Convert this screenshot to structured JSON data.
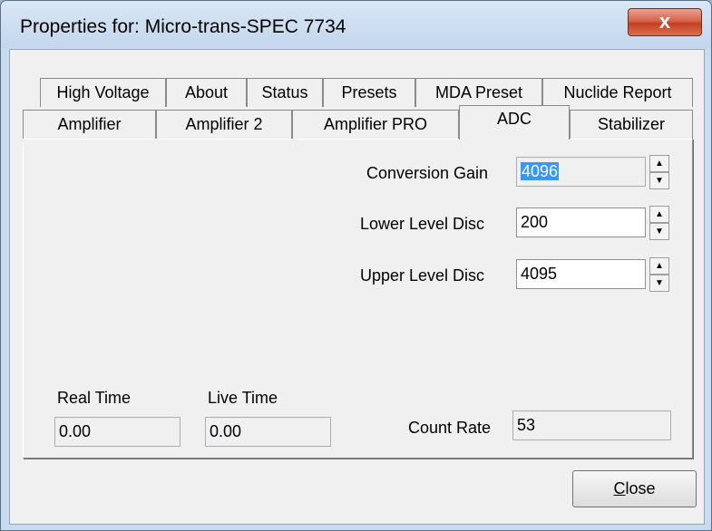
{
  "window": {
    "title": "Properties for: Micro-trans-SPEC 7734",
    "close_glyph": "x"
  },
  "tabs_row1": [
    "High Voltage",
    "About",
    "Status",
    "Presets",
    "MDA Preset",
    "Nuclide Report"
  ],
  "tabs_row2": [
    "Amplifier",
    "Amplifier 2",
    "Amplifier PRO",
    "ADC",
    "Stabilizer"
  ],
  "active_tab": "ADC",
  "settings": {
    "conversion_gain": {
      "label": "Conversion Gain",
      "value": "4096"
    },
    "lower_level_disc": {
      "label": "Lower Level Disc",
      "value": "200"
    },
    "upper_level_disc": {
      "label": "Upper Level Disc",
      "value": "4095"
    }
  },
  "readouts": {
    "real_time": {
      "label": "Real Time",
      "value": "0.00"
    },
    "live_time": {
      "label": "Live Time",
      "value": "0.00"
    },
    "count_rate": {
      "label": "Count Rate",
      "value": "53"
    }
  },
  "buttons": {
    "close_label_first": "C",
    "close_label_rest": "lose"
  },
  "spin": {
    "up": "▲",
    "down": "▼"
  }
}
